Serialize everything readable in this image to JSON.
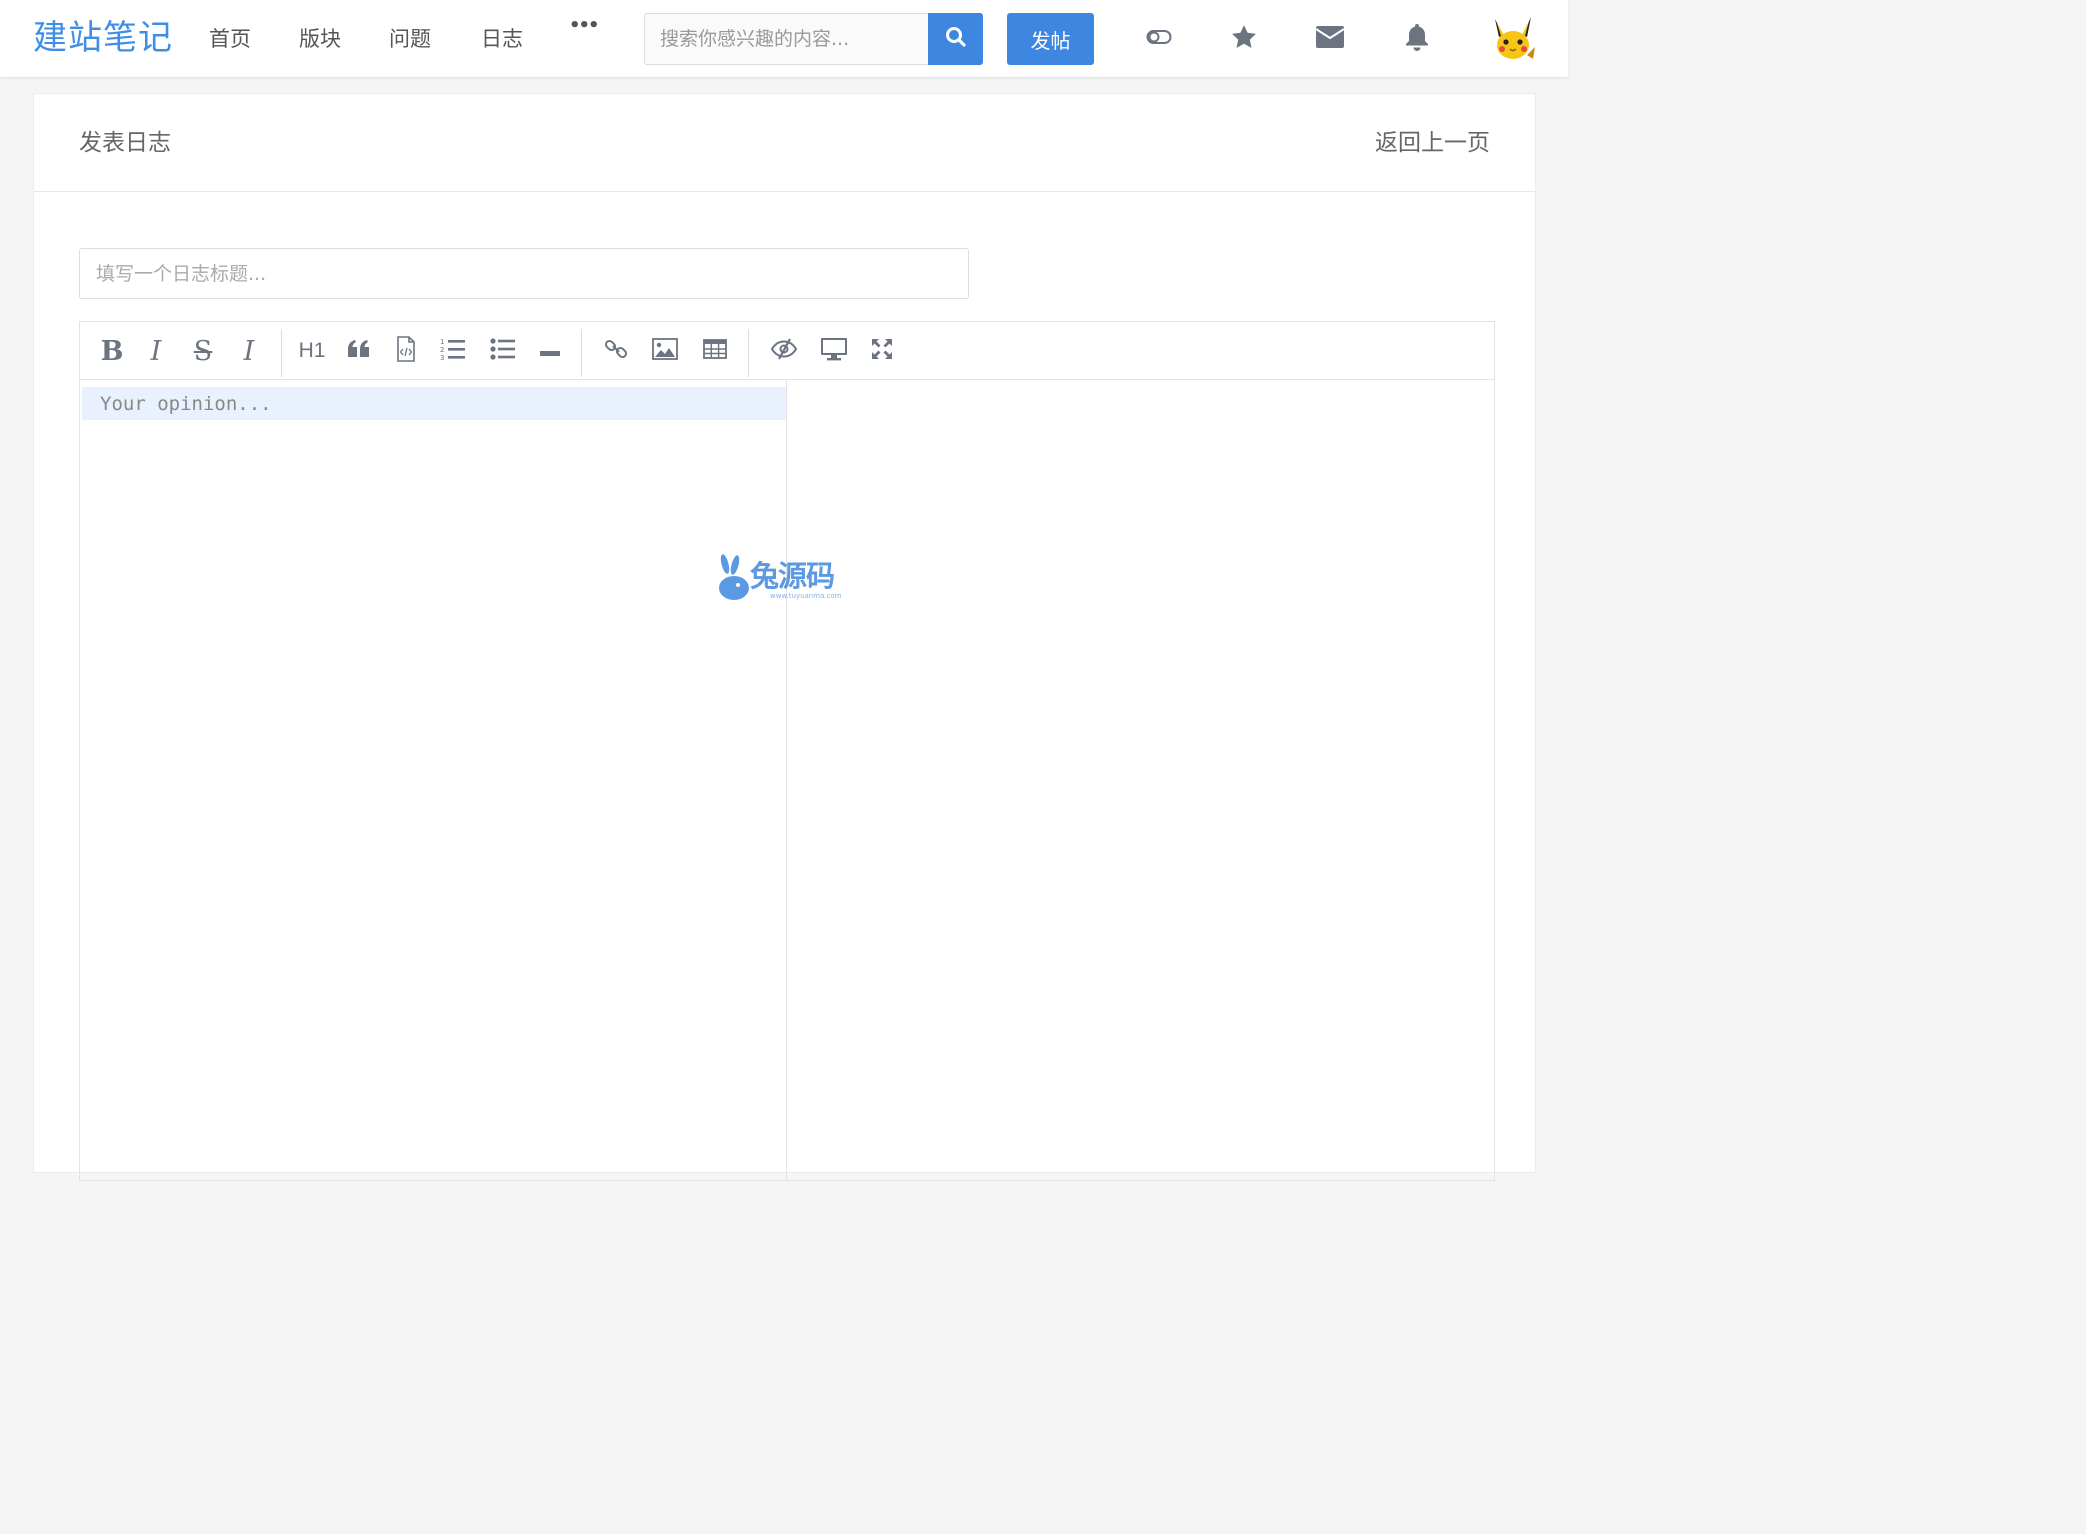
{
  "header": {
    "logo": "建站笔记",
    "nav": [
      "首页",
      "版块",
      "问题",
      "日志"
    ],
    "more": "•••",
    "search_placeholder": "搜索你感兴趣的内容...",
    "post_label": "发帖",
    "icons": [
      "toggle-icon",
      "star-icon",
      "mail-icon",
      "bell-icon"
    ]
  },
  "page": {
    "title": "发表日志",
    "back": "返回上一页"
  },
  "form": {
    "title_placeholder": "填写一个日志标题..."
  },
  "editor": {
    "placeholder": "Your opinion...",
    "toolbar": {
      "bold": "B",
      "italic": "I",
      "strike": "S",
      "clear_format": "I",
      "heading": "H1"
    }
  },
  "watermark": {
    "text": "兔源码",
    "sub": "www.tuyuanma.com"
  },
  "colors": {
    "accent": "#3d87e0",
    "logo": "#3f8ee6",
    "icon": "#6b7480"
  }
}
